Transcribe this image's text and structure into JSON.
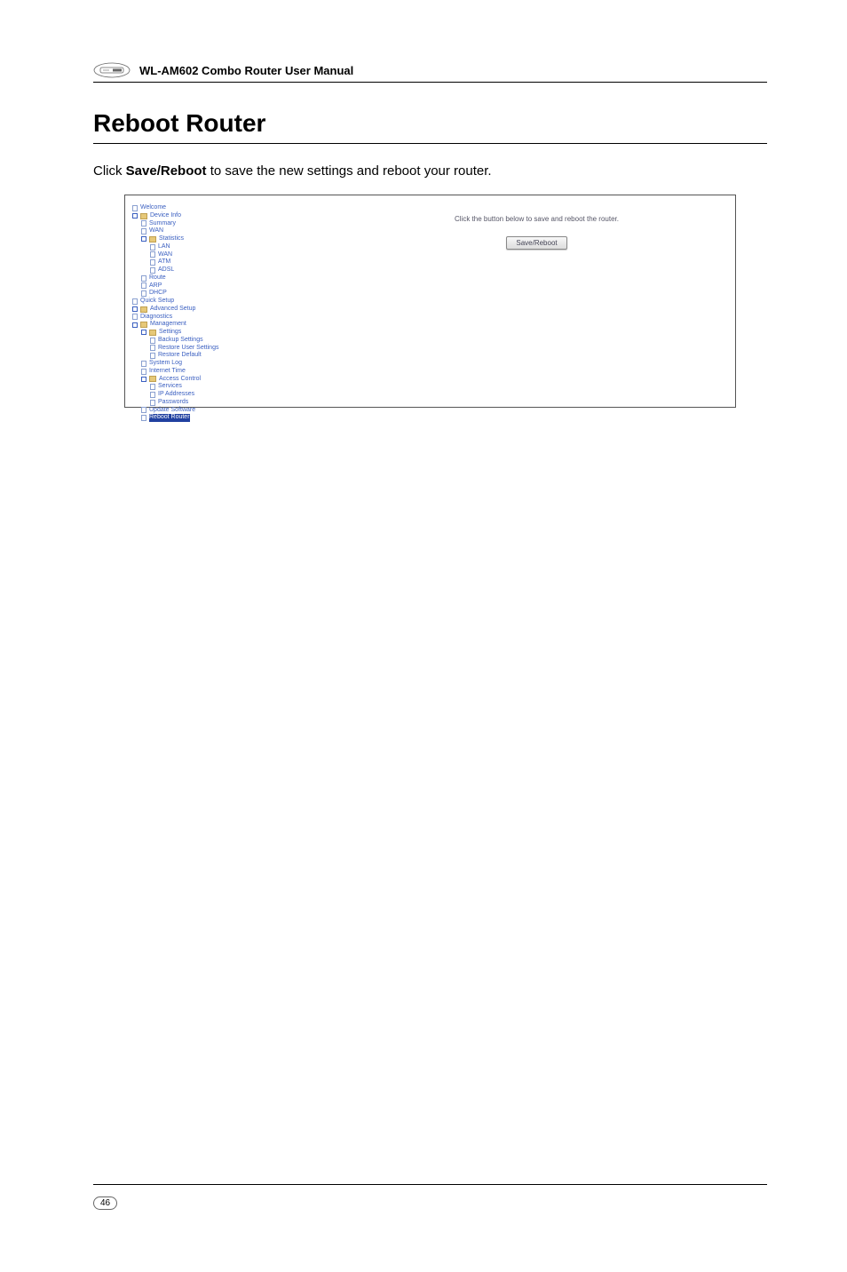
{
  "header": {
    "product": "WL-AM602 Combo Router User Manual"
  },
  "section": {
    "title": "Reboot Router",
    "body_prefix": "Click ",
    "body_bold": "Save/Reboot",
    "body_suffix": " to save the new settings and reboot your router."
  },
  "screenshot": {
    "nav": {
      "welcome": "Welcome",
      "device_info": "Device Info",
      "summary": "Summary",
      "wan": "WAN",
      "statistics": "Statistics",
      "lan": "LAN",
      "wan2": "WAN",
      "atm": "ATM",
      "adsl": "ADSL",
      "route": "Route",
      "arp": "ARP",
      "dhcp": "DHCP",
      "quick_setup": "Quick Setup",
      "advanced_setup": "Advanced Setup",
      "diagnostics": "Diagnostics",
      "management": "Management",
      "settings": "Settings",
      "backup_settings": "Backup Settings",
      "restore_user_settings": "Restore User Settings",
      "restore_default": "Restore Default",
      "system_log": "System Log",
      "internet_time": "Internet Time",
      "access_control": "Access Control",
      "services": "Services",
      "ip_addresses": "IP Addresses",
      "passwords": "Passwords",
      "update_software": "Update Software",
      "reboot_router": "Reboot Router"
    },
    "content": {
      "instruction": "Click the button below to save and reboot the router.",
      "button": "Save/Reboot"
    }
  },
  "footer": {
    "page": "46"
  }
}
